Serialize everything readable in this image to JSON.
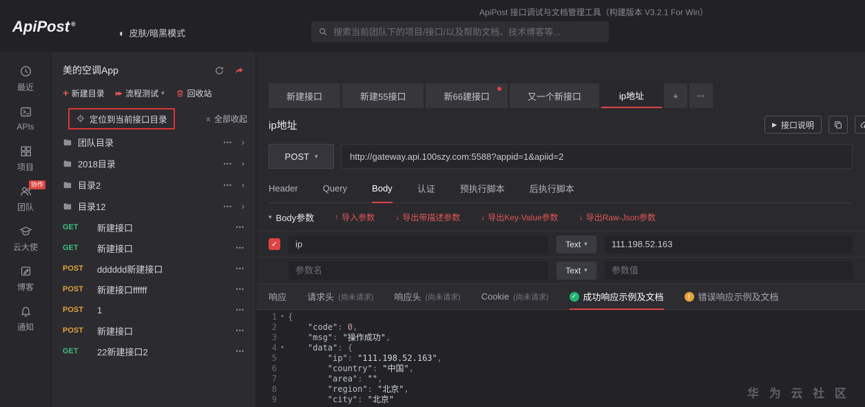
{
  "colors": {
    "accent": "#e04444",
    "link": "#e05555",
    "method_get": "#3fbf77",
    "method_post": "#e0a03c",
    "success_badge": "#21b573",
    "warning_badge": "#e6a23c"
  },
  "icons": {
    "toggle": "◐",
    "plus": "+",
    "more": "•••",
    "chevron_right": "›",
    "caret_down": "▾",
    "fold": "▾",
    "arrow_up": "↑",
    "arrow_down": "↓",
    "check": "✓",
    "exclaim": "!",
    "play": "▶",
    "flow": "▶▶"
  },
  "topbar": {
    "app_title": "ApiPost 接口调试与文档管理工具（构建版本 V3.2.1 For Win）",
    "logo": "ApiPost",
    "logo_mark": "®",
    "skin_toggle_label": "皮肤/暗黑模式",
    "search_placeholder": "搜索当前团队下的项目/接口/以及帮助文档、技术博客等..."
  },
  "nav": {
    "items": [
      {
        "id": "recent",
        "label": "最近"
      },
      {
        "id": "apis",
        "label": "APIs"
      },
      {
        "id": "projects",
        "label": "项目"
      },
      {
        "id": "team",
        "label": "团队",
        "badge": "协作"
      },
      {
        "id": "ambassador",
        "label": "云大使"
      },
      {
        "id": "blog",
        "label": "博客"
      },
      {
        "id": "notice",
        "label": "通知"
      }
    ]
  },
  "sidebar": {
    "project_title": "美的空调App",
    "new_dir_label": "新建目录",
    "flow_test_label": "流程测试",
    "recycle_label": "回收站",
    "locate_label": "定位到当前接口目录",
    "collapse_all_label": "全部收起",
    "folders": [
      {
        "label": "团队目录"
      },
      {
        "label": "2018目录"
      },
      {
        "label": "目录2"
      },
      {
        "label": "目录12"
      }
    ],
    "apis": [
      {
        "method": "GET",
        "label": "新建接口"
      },
      {
        "method": "GET",
        "label": "新建接口"
      },
      {
        "method": "POST",
        "label": "dddddd新建接口"
      },
      {
        "method": "POST",
        "label": "新建接口ffffff"
      },
      {
        "method": "POST",
        "label": "1"
      },
      {
        "method": "POST",
        "label": "新建接口"
      },
      {
        "method": "GET",
        "label": "22新建接口2"
      }
    ]
  },
  "main": {
    "tabs": [
      {
        "label": "新建接口",
        "active": false,
        "dot": false
      },
      {
        "label": "新建55接口",
        "active": false,
        "dot": false
      },
      {
        "label": "新66建接口",
        "active": false,
        "dot": true
      },
      {
        "label": "又一个新接口",
        "active": false,
        "dot": false
      },
      {
        "label": "ip地址",
        "active": true,
        "dot": false
      }
    ],
    "page_title": "ip地址",
    "doc_button_label": "接口说明",
    "request": {
      "method": "POST",
      "url": "http://gateway.api.100szy.com:5588?appid=1&apiid=2"
    },
    "request_tabs": [
      {
        "label": "Header",
        "active": false
      },
      {
        "label": "Query",
        "active": false
      },
      {
        "label": "Body",
        "active": true
      },
      {
        "label": "认证",
        "active": false
      },
      {
        "label": "预执行脚本",
        "active": false
      },
      {
        "label": "后执行脚本",
        "active": false
      }
    ],
    "body_panel": {
      "title": "Body参数",
      "links": [
        {
          "dir": "up",
          "label": "导入参数"
        },
        {
          "dir": "down",
          "label": "导出带描述参数"
        },
        {
          "dir": "down",
          "label": "导出Key-Value参数"
        },
        {
          "dir": "down",
          "label": "导出Raw-Json参数"
        }
      ]
    },
    "params": [
      {
        "checked": true,
        "name": "ip",
        "name_placeholder": "",
        "type": "Text",
        "value": "111.198.52.163",
        "value_placeholder": ""
      },
      {
        "checked": false,
        "name": "",
        "name_placeholder": "参数名",
        "type": "Text",
        "value": "",
        "value_placeholder": "参数值"
      }
    ],
    "response_tabs": [
      {
        "label": "响应"
      },
      {
        "label": "请求头",
        "note": "(尚未请求)"
      },
      {
        "label": "响应头",
        "note": "(尚未请求)"
      },
      {
        "label": "Cookie",
        "note": "(尚未请求)"
      },
      {
        "label": "成功响应示例及文档",
        "icon": "success",
        "active": true
      },
      {
        "label": "错误响应示例及文档",
        "icon": "error"
      }
    ],
    "code": {
      "lines": [
        {
          "num": 1,
          "fold": true,
          "tokens": [
            [
              "{",
              "punc"
            ]
          ]
        },
        {
          "num": 2,
          "fold": false,
          "tokens": [
            [
              "    ",
              ""
            ],
            [
              "\"code\"",
              "key"
            ],
            [
              ": ",
              "punc"
            ],
            [
              "0",
              "num"
            ],
            [
              ",",
              "punc"
            ]
          ]
        },
        {
          "num": 3,
          "fold": false,
          "tokens": [
            [
              "    ",
              ""
            ],
            [
              "\"msg\"",
              "key"
            ],
            [
              ": ",
              "punc"
            ],
            [
              "\"操作成功\"",
              "str"
            ],
            [
              ",",
              "punc"
            ]
          ]
        },
        {
          "num": 4,
          "fold": true,
          "tokens": [
            [
              "    ",
              ""
            ],
            [
              "\"data\"",
              "key"
            ],
            [
              ": ",
              "punc"
            ],
            [
              "{",
              "punc"
            ]
          ]
        },
        {
          "num": 5,
          "fold": false,
          "tokens": [
            [
              "        ",
              ""
            ],
            [
              "\"ip\"",
              "key"
            ],
            [
              ": ",
              "punc"
            ],
            [
              "\"111.198.52.163\"",
              "str"
            ],
            [
              ",",
              "punc"
            ]
          ]
        },
        {
          "num": 6,
          "fold": false,
          "tokens": [
            [
              "        ",
              ""
            ],
            [
              "\"country\"",
              "key"
            ],
            [
              ": ",
              "punc"
            ],
            [
              "\"中国\"",
              "str"
            ],
            [
              ",",
              "punc"
            ]
          ]
        },
        {
          "num": 7,
          "fold": false,
          "tokens": [
            [
              "        ",
              ""
            ],
            [
              "\"area\"",
              "key"
            ],
            [
              ": ",
              "punc"
            ],
            [
              "\"\"",
              "str"
            ],
            [
              ",",
              "punc"
            ]
          ]
        },
        {
          "num": 8,
          "fold": false,
          "tokens": [
            [
              "        ",
              ""
            ],
            [
              "\"region\"",
              "key"
            ],
            [
              ": ",
              "punc"
            ],
            [
              "\"北京\"",
              "str"
            ],
            [
              ",",
              "punc"
            ]
          ]
        },
        {
          "num": 9,
          "fold": false,
          "tokens": [
            [
              "        ",
              ""
            ],
            [
              "\"city\"",
              "key"
            ],
            [
              ": ",
              "punc"
            ],
            [
              "\"北京\"",
              "str"
            ]
          ]
        }
      ]
    },
    "watermark": "华 为 云 社 区"
  }
}
